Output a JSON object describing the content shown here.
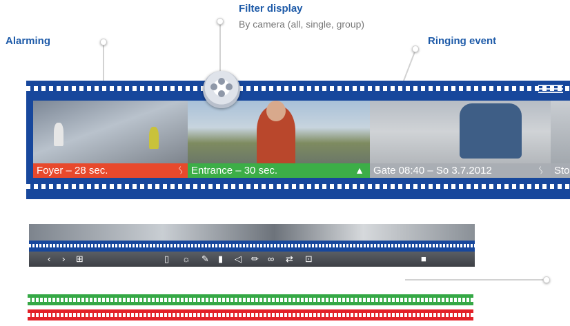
{
  "callouts": {
    "alarming": {
      "title": "Alarming"
    },
    "filter": {
      "title": "Filter display",
      "subtitle": "By camera (all, single, group)"
    },
    "ringing": {
      "title": "Ringing event"
    }
  },
  "film": {
    "frames": [
      {
        "label": "Foyer – 28 sec.",
        "color": "#e8492c",
        "icon": "alarm-pulse-icon",
        "icon_glyph": "ᛊ"
      },
      {
        "label": "Entrance – 30 sec.",
        "color": "#3cae47",
        "icon": "bell-icon",
        "icon_glyph": "🔔"
      },
      {
        "label": "Gate 08:40 – So 3.7.2012",
        "color": "#a8adb4",
        "icon": "alarm-pulse-icon",
        "icon_glyph": "ᛊ"
      },
      {
        "label": "Sto",
        "color": "#a8adb4"
      }
    ],
    "menu_icon": "menu-icon"
  },
  "toolbar": {
    "icons": [
      {
        "name": "previous-icon",
        "glyph": "‹"
      },
      {
        "name": "next-icon",
        "glyph": "›"
      },
      {
        "name": "layout-icon",
        "glyph": "⊞"
      },
      {
        "name": "door-icon",
        "glyph": "▯"
      },
      {
        "name": "light-icon",
        "glyph": "☼"
      },
      {
        "name": "switch-icon",
        "glyph": "✎"
      },
      {
        "name": "thermometer-icon",
        "glyph": "🌡"
      },
      {
        "name": "speaker-icon",
        "glyph": "◁"
      },
      {
        "name": "microphone-icon",
        "glyph": "🎤"
      },
      {
        "name": "link-icon",
        "glyph": "∞"
      },
      {
        "name": "switch-view-icon",
        "glyph": "⇄"
      },
      {
        "name": "snapshot-icon",
        "glyph": "⊡"
      },
      {
        "name": "lock-icon",
        "glyph": "🔒"
      }
    ]
  },
  "colors": {
    "brand_blue": "#17479c",
    "title_blue": "#1d5aa8",
    "alarm_red": "#e8492c",
    "ring_green": "#3cae47",
    "strip_green": "#35a845",
    "strip_red": "#e32128"
  }
}
